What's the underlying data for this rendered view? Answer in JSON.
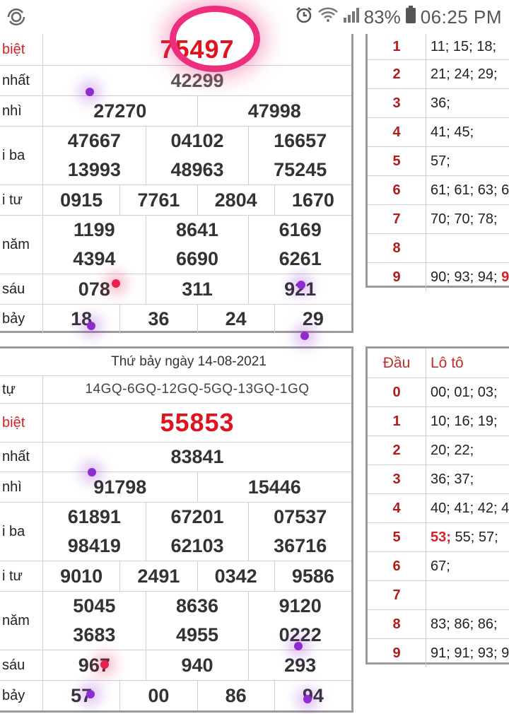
{
  "status_bar": {
    "battery": "83%",
    "time": "06:25 PM"
  },
  "top_results": {
    "rows": [
      {
        "label": "biệt",
        "values": [
          "75497"
        ],
        "special": true
      },
      {
        "label": "nhất",
        "values": [
          "42299"
        ]
      },
      {
        "label": "nhì",
        "values": [
          "27270",
          "47998"
        ]
      },
      {
        "label": "i ba",
        "lines": [
          [
            "47667",
            "04102",
            "16657"
          ],
          [
            "13993",
            "48963",
            "75245"
          ]
        ]
      },
      {
        "label": "i tư",
        "values": [
          "0915",
          "7761",
          "2804",
          "1670"
        ]
      },
      {
        "label": "năm",
        "lines": [
          [
            "1199",
            "8641",
            "6169"
          ],
          [
            "4394",
            "6690",
            "6261"
          ]
        ]
      },
      {
        "label": "sáu",
        "values": [
          "078",
          "311",
          "921"
        ]
      },
      {
        "label": "bảy",
        "values": [
          "18",
          "36",
          "24",
          "29"
        ]
      }
    ]
  },
  "top_loto": [
    {
      "digit": "1",
      "nums": "11; 15; 18;"
    },
    {
      "digit": "2",
      "nums": "21; 24; 29;"
    },
    {
      "digit": "3",
      "nums": "36;"
    },
    {
      "digit": "4",
      "nums": "41; 45;"
    },
    {
      "digit": "5",
      "nums": "57;"
    },
    {
      "digit": "6",
      "nums": "61; 61; 63; 6"
    },
    {
      "digit": "7",
      "nums": "70; 70; 78;"
    },
    {
      "digit": "8",
      "nums": ""
    },
    {
      "digit": "9",
      "nums": "90; 93; 94;",
      "tail": "9"
    }
  ],
  "bottom_results": {
    "date": "Thứ bảy ngày 14-08-2021",
    "codes_label": "tự",
    "codes": "14GQ-6GQ-12GQ-5GQ-13GQ-1GQ",
    "rows": [
      {
        "label": "biệt",
        "values": [
          "55853"
        ],
        "special": true
      },
      {
        "label": "nhất",
        "values": [
          "83841"
        ]
      },
      {
        "label": "nhì",
        "values": [
          "91798",
          "15446"
        ]
      },
      {
        "label": "i ba",
        "lines": [
          [
            "61891",
            "67201",
            "07537"
          ],
          [
            "98419",
            "62103",
            "36716"
          ]
        ]
      },
      {
        "label": "i tư",
        "values": [
          "9010",
          "2491",
          "0342",
          "9586"
        ]
      },
      {
        "label": "năm",
        "lines": [
          [
            "5045",
            "8636",
            "9120"
          ],
          [
            "3683",
            "4955",
            "0222"
          ]
        ]
      },
      {
        "label": "sáu",
        "values": [
          "967",
          "940",
          "293"
        ]
      },
      {
        "label": "bảy",
        "values": [
          "57",
          "00",
          "86",
          "94"
        ]
      }
    ]
  },
  "bottom_loto": {
    "header": {
      "digit": "Đầu",
      "nums": "Lô tô"
    },
    "rows": [
      {
        "digit": "0",
        "nums": "00; 01; 03;"
      },
      {
        "digit": "1",
        "nums": "10; 16; 19;"
      },
      {
        "digit": "2",
        "nums": "20; 22;"
      },
      {
        "digit": "3",
        "nums": "36; 37;"
      },
      {
        "digit": "4",
        "nums": "40; 41; 42; 4"
      },
      {
        "digit": "5",
        "nums": "55; 57;",
        "lead": "53;"
      },
      {
        "digit": "6",
        "nums": "67;"
      },
      {
        "digit": "7",
        "nums": ""
      },
      {
        "digit": "8",
        "nums": "83; 86; 86;"
      },
      {
        "digit": "9",
        "nums": "91; 91; 93; 9"
      }
    ]
  },
  "colors": {
    "special": "#e0141f",
    "digit": "#b01b1b",
    "annotation_circle": "#ec2e7c",
    "annotation_dot": "#8e2bd1"
  }
}
